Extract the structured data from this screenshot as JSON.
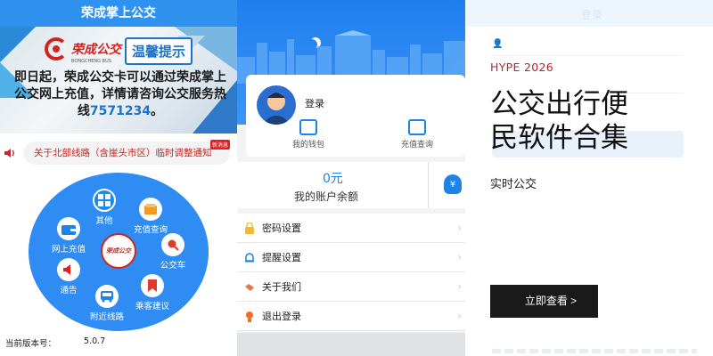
{
  "panel1": {
    "header_title": "荣成掌上公交",
    "banner": {
      "logo_text": "荣成公交",
      "logo_sub": "RONGCHENG BUS",
      "warm_tip": "温馨提示",
      "notice_pre": "即日起，荣成公交卡可以通过荣成掌上公交网上充值，详情请咨询公交服务热线",
      "hotline": "7571234",
      "notice_post": "。"
    },
    "ticker": {
      "text": "关于北部线路（含崖头市区）临时调整通知",
      "badge": "新消息"
    },
    "menu": {
      "other": "其他",
      "recharge_query": "充值查询",
      "online_recharge": "网上充值",
      "bus": "公交车",
      "notice": "通告",
      "nearby_lines": "附近线路",
      "suggestion": "乘客建议",
      "center_logo": "荣成公交"
    },
    "version_label": "当前版本号：",
    "version_value": "5.0.7"
  },
  "panel2": {
    "login": "登录",
    "my_wallet": "我的钱包",
    "recharge_query": "充值查询",
    "balance_amount": "0元",
    "balance_label": "我的账户余额",
    "list": [
      "密码设置",
      "提醒设置",
      "关于我们",
      "退出登录"
    ]
  },
  "panel3": {
    "ghost_title": "登录",
    "eyebrow": "HYPE 2026",
    "title_line1": "公交出行便",
    "title_line2": "民软件合集",
    "subtitle": "实时公交",
    "cta": "立即查看 >"
  },
  "colors": {
    "primary_blue": "#2f92ef",
    "brand_red": "#d3231f",
    "accent_red": "#b5252b",
    "cta_black": "#1a1a1a"
  }
}
